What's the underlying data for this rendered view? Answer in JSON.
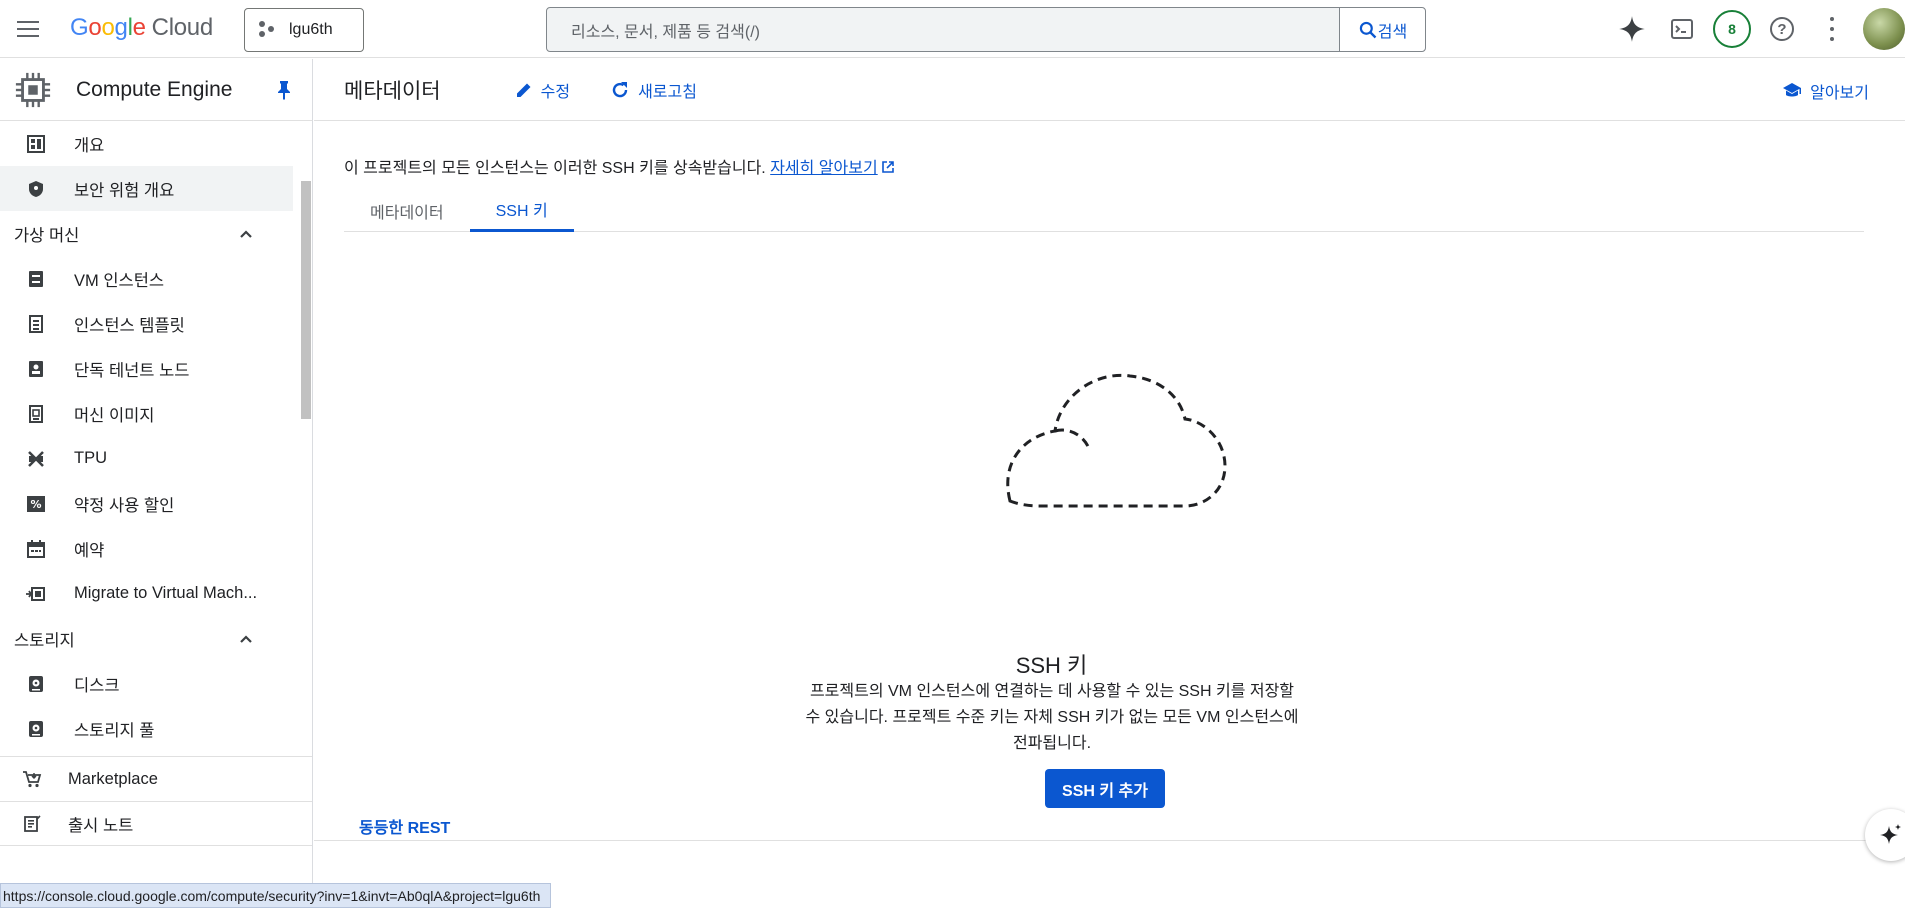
{
  "topbar": {
    "logo_google": "Google",
    "logo_cloud": "Cloud",
    "project": "lgu6th",
    "search_placeholder": "리소스, 문서, 제품 등 검색(/)",
    "search_button": "검색",
    "notification_count": "8"
  },
  "sidebar": {
    "title": "Compute Engine",
    "items_top": [
      {
        "label": "개요",
        "icon": "dashboard-icon"
      },
      {
        "label": "보안 위험 개요",
        "icon": "shield-icon"
      }
    ],
    "section_vm": "가상 머신",
    "items_vm": [
      {
        "label": "VM 인스턴스",
        "icon": "vm-instance-icon"
      },
      {
        "label": "인스턴스 템플릿",
        "icon": "instance-template-icon"
      },
      {
        "label": "단독 테넌트 노드",
        "icon": "sole-tenant-icon"
      },
      {
        "label": "머신 이미지",
        "icon": "machine-image-icon"
      },
      {
        "label": "TPU",
        "icon": "tpu-icon"
      },
      {
        "label": "약정 사용 할인",
        "icon": "discount-icon"
      },
      {
        "label": "예약",
        "icon": "calendar-icon"
      },
      {
        "label": "Migrate to Virtual Mach...",
        "icon": "migrate-icon"
      }
    ],
    "section_storage": "스토리지",
    "items_storage": [
      {
        "label": "디스크",
        "icon": "disk-icon"
      },
      {
        "label": "스토리지 풀",
        "icon": "storage-pool-icon"
      }
    ],
    "bottom_items": [
      {
        "label": "Marketplace",
        "icon": "cart-icon"
      },
      {
        "label": "출시 노트",
        "icon": "release-notes-icon"
      }
    ]
  },
  "content": {
    "page_title": "메타데이터",
    "edit_label": "수정",
    "refresh_label": "새로고침",
    "learn_label": "알아보기",
    "intro_text": "이 프로젝트의 모든 인스턴스는 이러한 SSH 키를 상속받습니다.",
    "intro_link": "자세히 알아보기",
    "tabs": [
      "메타데이터",
      "SSH 키"
    ],
    "active_tab": "SSH 키",
    "empty_title": "SSH 키",
    "empty_desc": "프로젝트의 VM 인스턴스에 연결하는 데 사용할 수 있는 SSH 키를 저장할 수 있습니다. 프로젝트 수준 키는 자체 SSH 키가 없는 모든 VM 인스턴스에 전파됩니다.",
    "add_button": "SSH 키 추가",
    "rest_link": "동등한 REST"
  },
  "status_url": "https://console.cloud.google.com/compute/security?inv=1&invt=Ab0qlA&project=lgu6th",
  "colors": {
    "accent": "#0b57d0",
    "badge": "#188038"
  }
}
